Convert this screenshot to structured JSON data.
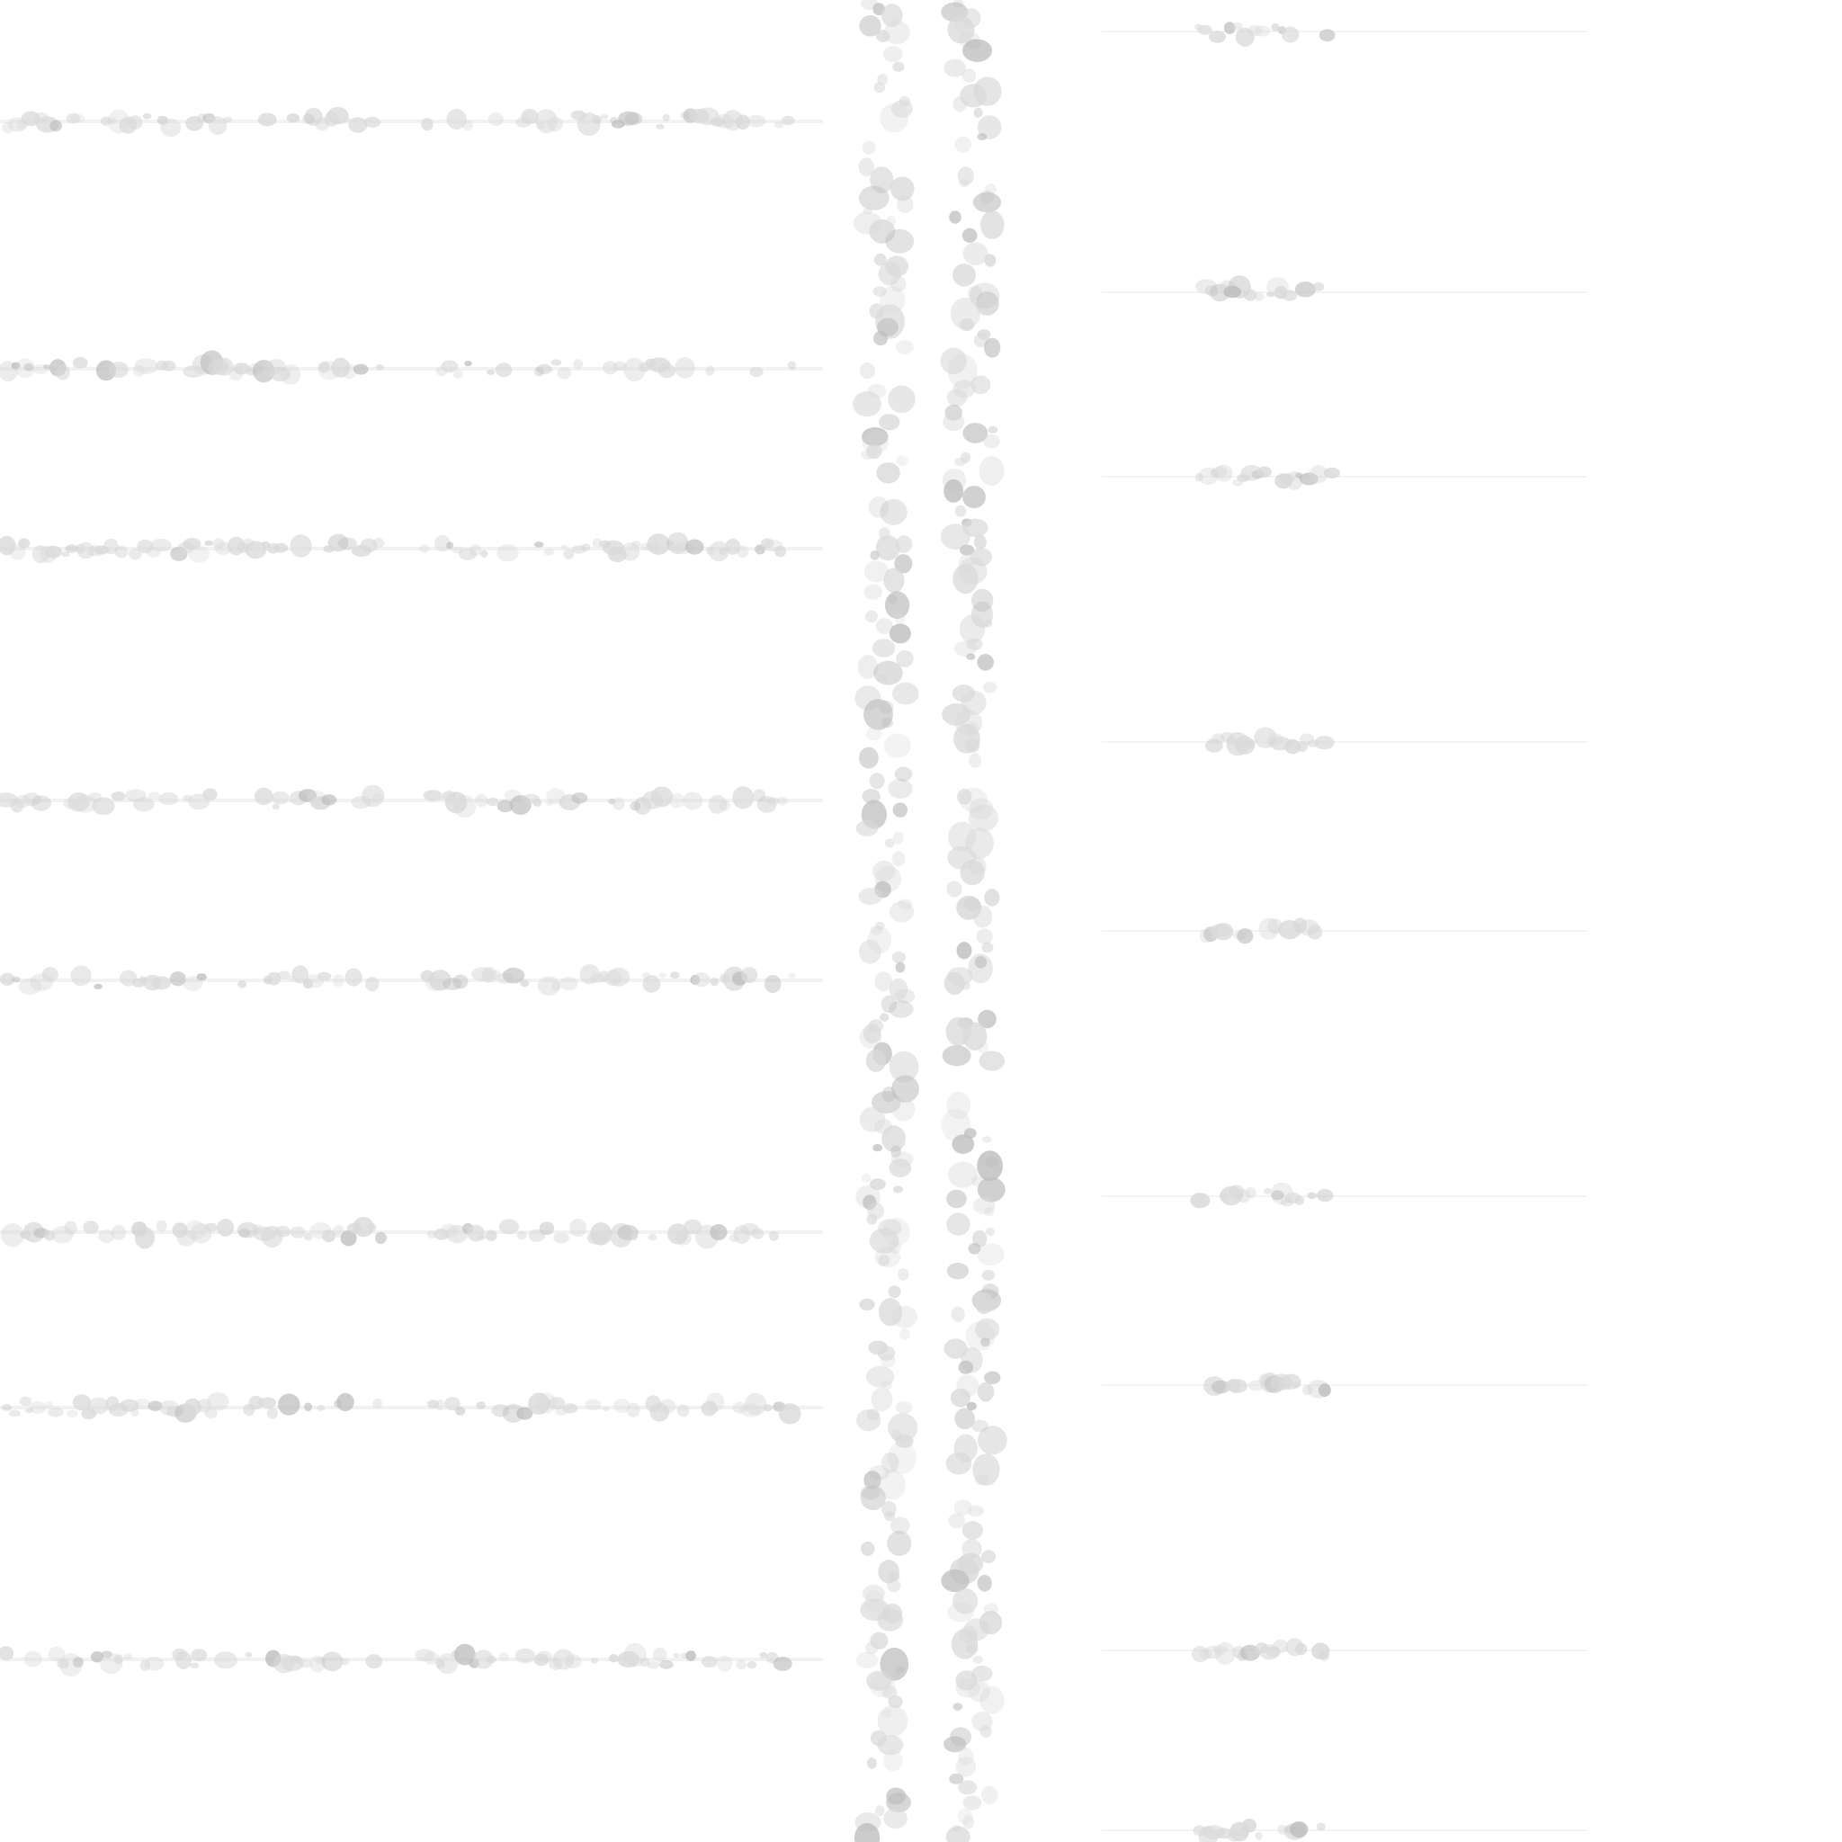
{
  "scene": {
    "description_visible_text": "",
    "background_color": "#ffffff",
    "mark_color": "#d9d9d9",
    "mark_color_dark": "#bdbdbd",
    "left_rows": 10,
    "right_ticks": 12
  }
}
